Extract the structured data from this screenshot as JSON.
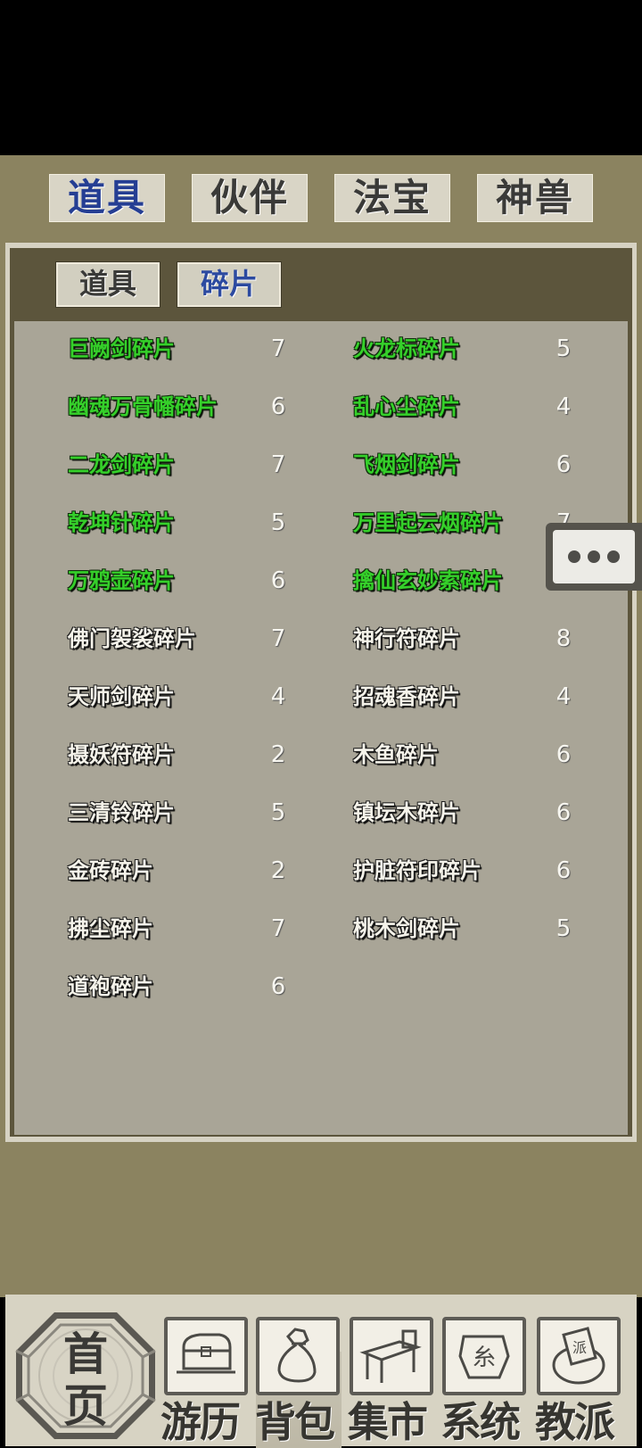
{
  "top_tabs": [
    {
      "label": "道具",
      "active": true
    },
    {
      "label": "伙伴",
      "active": false
    },
    {
      "label": "法宝",
      "active": false
    },
    {
      "label": "神兽",
      "active": false
    }
  ],
  "sub_tabs": [
    {
      "label": "道具",
      "active": false
    },
    {
      "label": "碎片",
      "active": true
    }
  ],
  "items_left": [
    {
      "name": "巨阙剑碎片",
      "count": "7",
      "color": "#35d02a"
    },
    {
      "name": "幽魂万骨幡碎片",
      "count": "6",
      "color": "#35d02a"
    },
    {
      "name": "二龙剑碎片",
      "count": "7",
      "color": "#35d02a"
    },
    {
      "name": "乾坤针碎片",
      "count": "5",
      "color": "#35d02a"
    },
    {
      "name": "万鸦壶碎片",
      "count": "6",
      "color": "#35d02a"
    },
    {
      "name": "佛门袈裟碎片",
      "count": "7",
      "color": "#f5f3ea"
    },
    {
      "name": "天师剑碎片",
      "count": "4",
      "color": "#f5f3ea"
    },
    {
      "name": "摄妖符碎片",
      "count": "2",
      "color": "#f5f3ea"
    },
    {
      "name": "三清铃碎片",
      "count": "5",
      "color": "#f5f3ea"
    },
    {
      "name": "金砖碎片",
      "count": "2",
      "color": "#f5f3ea"
    },
    {
      "name": "拂尘碎片",
      "count": "7",
      "color": "#f5f3ea"
    },
    {
      "name": "道袍碎片",
      "count": "6",
      "color": "#f5f3ea"
    }
  ],
  "items_right": [
    {
      "name": "火龙标碎片",
      "count": "5",
      "color": "#35d02a"
    },
    {
      "name": "乱心尘碎片",
      "count": "4",
      "color": "#35d02a"
    },
    {
      "name": "飞烟剑碎片",
      "count": "6",
      "color": "#35d02a"
    },
    {
      "name": "万里起云烟碎片",
      "count": "7",
      "color": "#35d02a"
    },
    {
      "name": "擒仙玄妙索碎片",
      "count": "",
      "color": "#35d02a"
    },
    {
      "name": "神行符碎片",
      "count": "8",
      "color": "#f5f3ea"
    },
    {
      "name": "招魂香碎片",
      "count": "4",
      "color": "#f5f3ea"
    },
    {
      "name": "木鱼碎片",
      "count": "6",
      "color": "#f5f3ea"
    },
    {
      "name": "镇坛木碎片",
      "count": "6",
      "color": "#f5f3ea"
    },
    {
      "name": "护脏符印碎片",
      "count": "6",
      "color": "#f5f3ea"
    },
    {
      "name": "桃木剑碎片",
      "count": "5",
      "color": "#f5f3ea"
    }
  ],
  "home": {
    "line1": "首",
    "line2": "页",
    "icon": "home-octagon-icon"
  },
  "bottom_nav": [
    {
      "label": "游历",
      "icon": "treasure-chest-icon"
    },
    {
      "label": "背包",
      "icon": "cloth-bag-icon",
      "active": true
    },
    {
      "label": "集市",
      "icon": "market-stall-icon"
    },
    {
      "label": "系统",
      "icon": "system-seal-icon"
    },
    {
      "label": "教派",
      "icon": "sect-banner-icon"
    }
  ],
  "more_button": {
    "icon": "more-dots-icon"
  }
}
